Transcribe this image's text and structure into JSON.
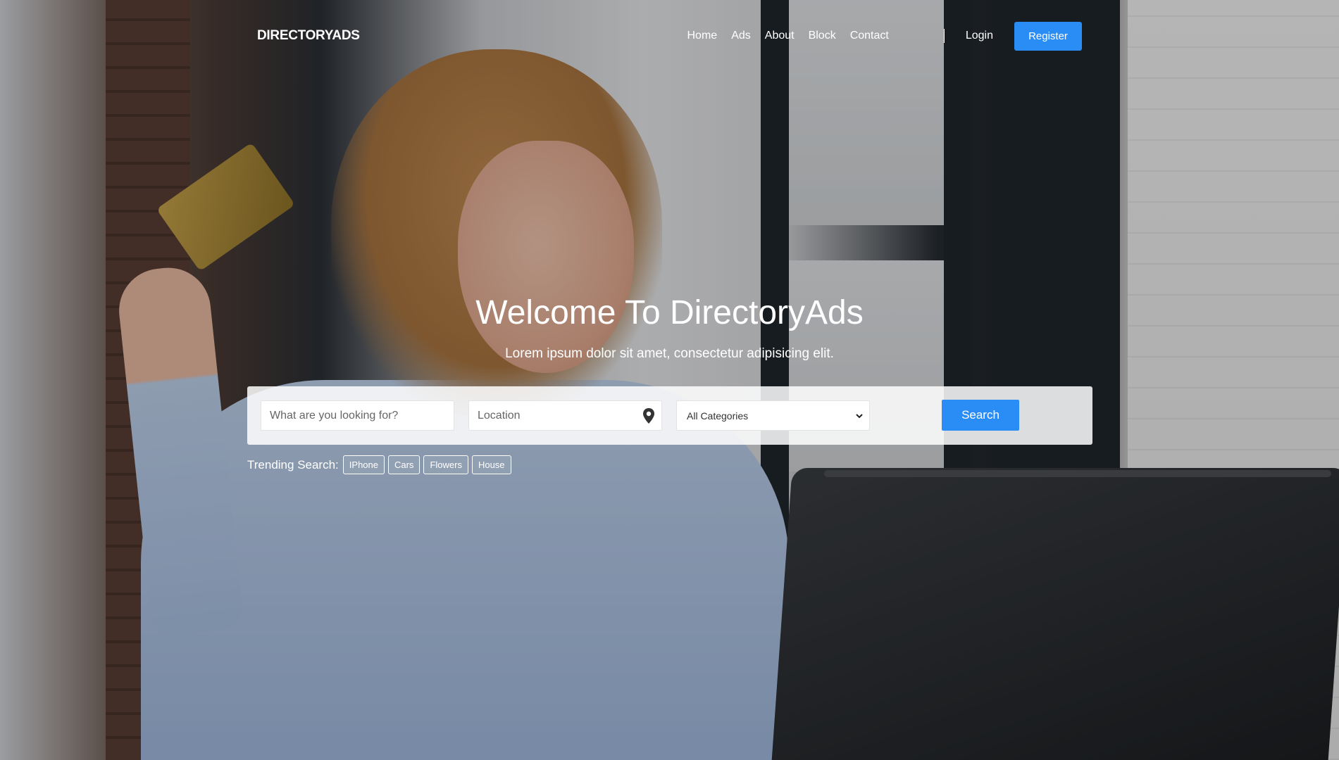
{
  "brand": "DIRECTORYADS",
  "nav": {
    "links": [
      "Home",
      "Ads",
      "About",
      "Block",
      "Contact"
    ],
    "login": "Login",
    "register": "Register"
  },
  "hero": {
    "title": "Welcome To DirectoryAds",
    "subtitle": "Lorem ipsum dolor sit amet, consectetur adipisicing elit."
  },
  "search": {
    "what_placeholder": "What are you looking for?",
    "location_placeholder": "Location",
    "category_selected": "All Categories",
    "button": "Search",
    "location_icon": "map-pin-icon",
    "category_icon": "chevron-down-icon"
  },
  "trending": {
    "label": "Trending Search:",
    "tags": [
      "IPhone",
      "Cars",
      "Flowers",
      "House"
    ]
  },
  "colors": {
    "accent": "#2a8cf5",
    "text_on_dark": "#ffffff"
  }
}
